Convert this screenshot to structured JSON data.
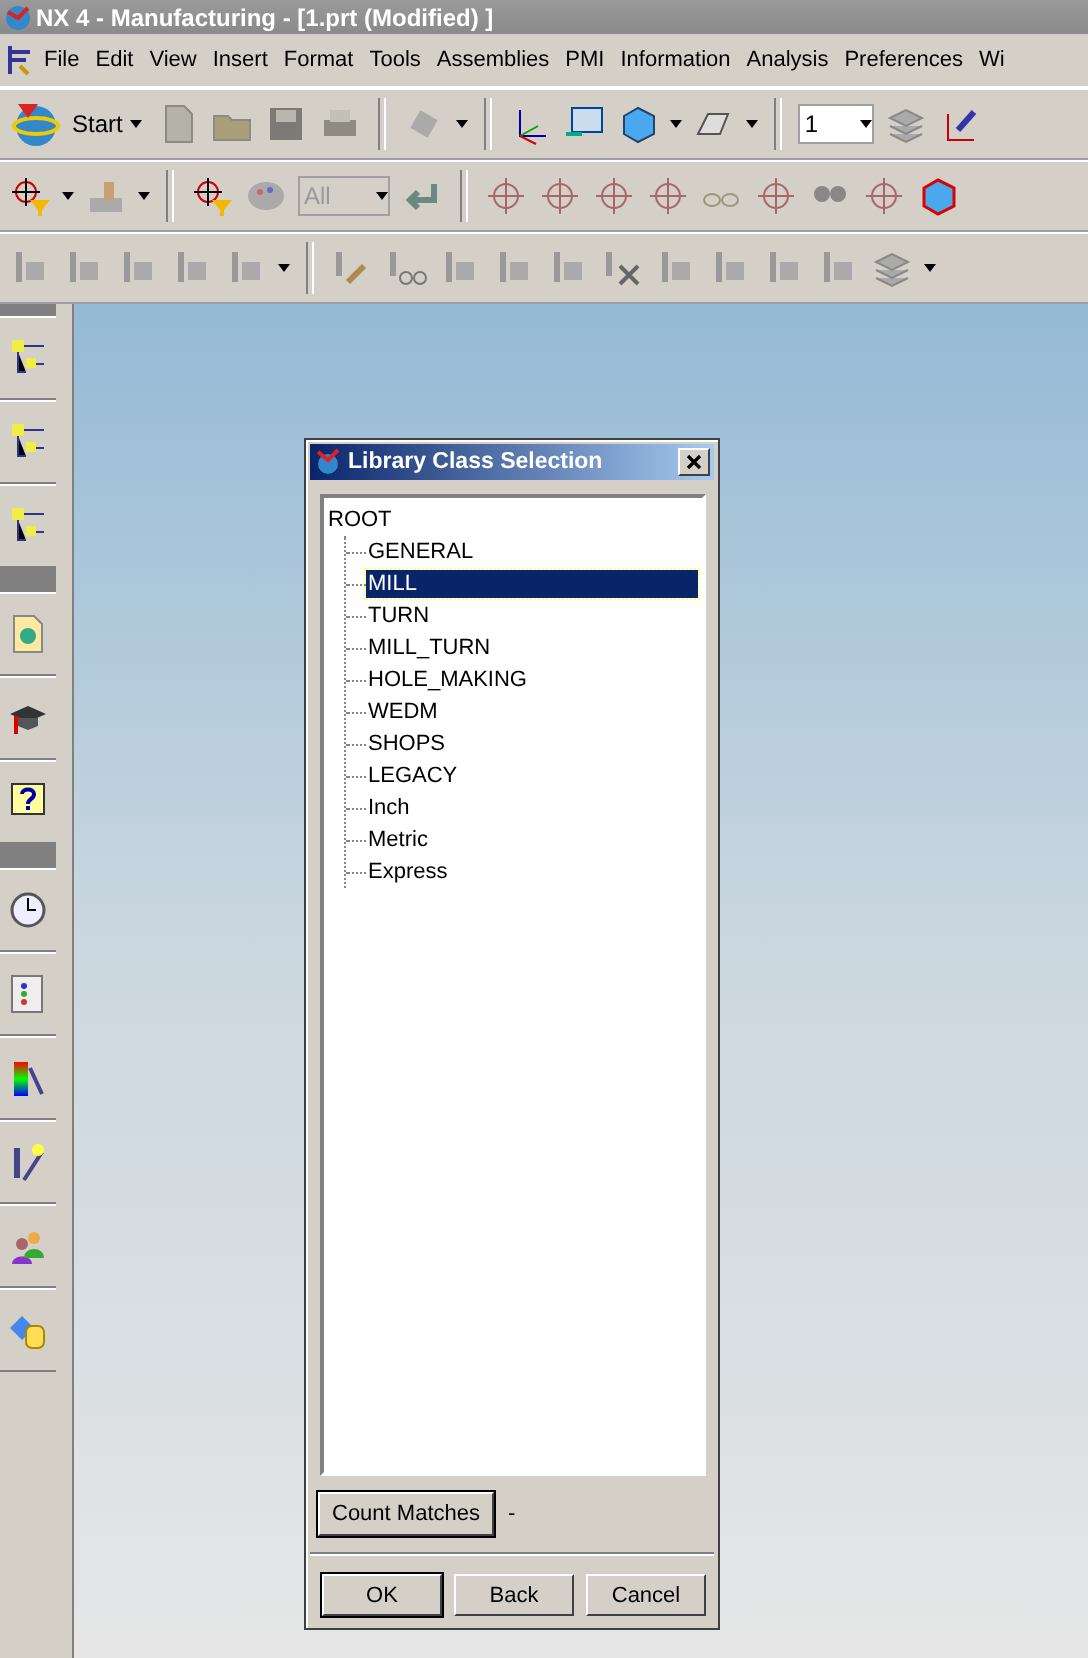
{
  "window": {
    "title": "NX 4 - Manufacturing - [1.prt (Modified) ]"
  },
  "menu": [
    "File",
    "Edit",
    "View",
    "Insert",
    "Format",
    "Tools",
    "Assemblies",
    "PMI",
    "Information",
    "Analysis",
    "Preferences",
    "Wi"
  ],
  "toolbar": {
    "start_label": "Start",
    "layer_value": "1",
    "filter_value": "All"
  },
  "dialog": {
    "title": "Library Class Selection",
    "tree": {
      "label": "ROOT",
      "children": [
        {
          "label": "GENERAL",
          "selected": false
        },
        {
          "label": "MILL",
          "selected": true
        },
        {
          "label": "TURN",
          "selected": false
        },
        {
          "label": "MILL_TURN",
          "selected": false
        },
        {
          "label": "HOLE_MAKING",
          "selected": false
        },
        {
          "label": "WEDM",
          "selected": false
        },
        {
          "label": "SHOPS",
          "selected": false
        },
        {
          "label": "LEGACY",
          "selected": false
        },
        {
          "label": "Inch",
          "selected": false
        },
        {
          "label": "Metric",
          "selected": false
        },
        {
          "label": "Express",
          "selected": false
        }
      ]
    },
    "count_button": "Count Matches",
    "count_result": "-",
    "buttons": [
      "OK",
      "Back",
      "Cancel"
    ]
  }
}
